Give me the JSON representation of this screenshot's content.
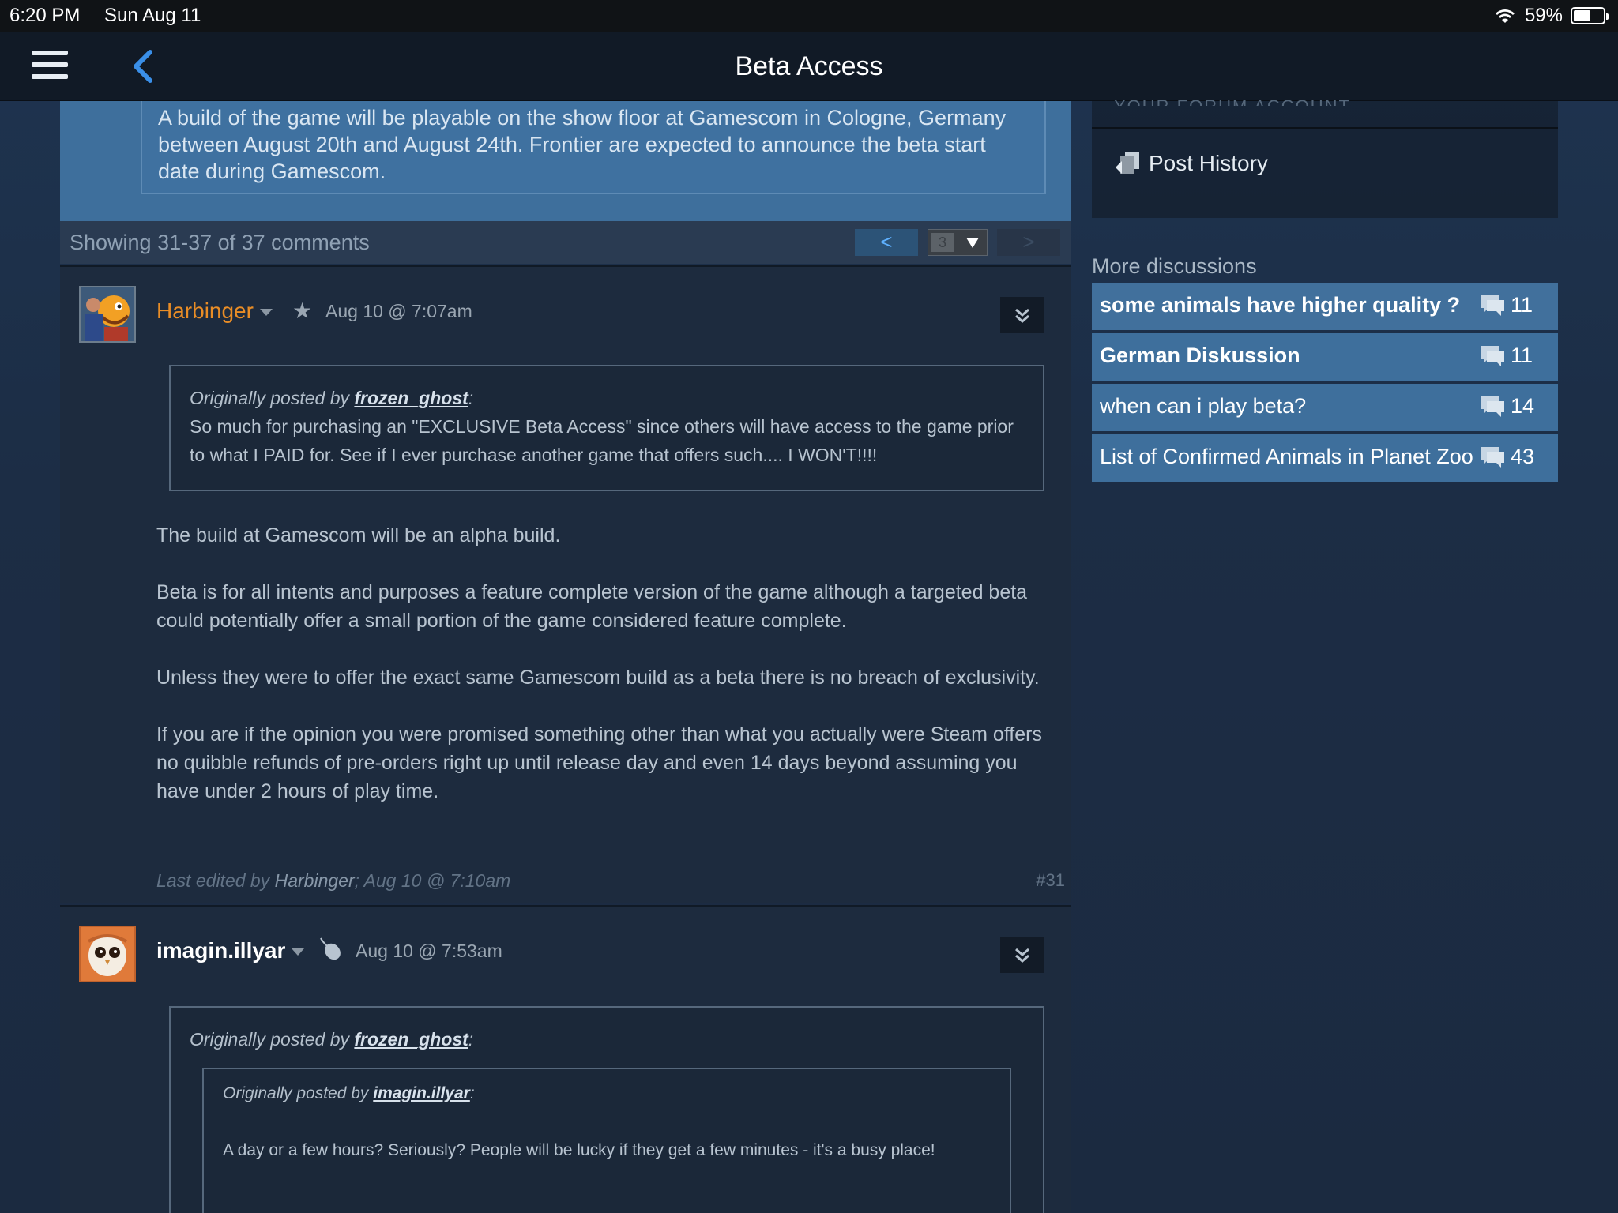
{
  "status_bar": {
    "time": "6:20 PM",
    "date": "Sun Aug 11",
    "battery": "59%",
    "battery_level": 0.59
  },
  "nav": {
    "title": "Beta Access",
    "menu_icon": "hamburger-icon",
    "back_icon": "chevron-left-icon"
  },
  "topic": {
    "quote_text": "A build of the game will be playable on the show floor at Gamescom in Cologne, Germany between August 20th and August 24th. Frontier are expected to announce the beta start date during Gamescom."
  },
  "pager": {
    "count": "Showing 31-37 of 37 comments",
    "prev_label": "<",
    "next_label": ">",
    "page_value": "3"
  },
  "comments": [
    {
      "author": "Harbinger",
      "badge": "★",
      "timestamp": "Aug 10 @ 7:07am",
      "quote_prefix": "Originally posted by",
      "quote_author": "frozen_ghost",
      "quote_suffix": ":",
      "quote_text": "So much for purchasing an \"EXCLUSIVE Beta Access\" since others will have access to the game prior to what I PAID for. See if I ever purchase another game that offers such.... I WON'T!!!!",
      "paragraphs": [
        "The build at Gamescom will be an alpha build.",
        "Beta is for all intents and purposes a feature complete version of the game although a targeted beta could potentially offer a small portion of the game considered feature complete.",
        "Unless they were to offer the exact same Gamescom build as a beta there is no breach of exclusivity.",
        "If you are if the opinion you were promised something other than what you actually were Steam offers no quibble refunds of pre-orders right up until release day and even 14 days beyond assuming you have under 2 hours of play time."
      ],
      "edit_prefix": "Last edited by",
      "edit_author": "Harbinger",
      "edit_suffix": "; Aug 10 @ 7:10am",
      "post_number": "#31"
    },
    {
      "author": "imagin.illyar",
      "timestamp": "Aug 10 @ 7:53am",
      "quote_prefix": "Originally posted by",
      "quote_author": "frozen_ghost",
      "quote_suffix": ":",
      "inner_quote_prefix": "Originally posted by",
      "inner_quote_author": "imagin.illyar",
      "inner_quote_suffix": ":",
      "inner_quote_text": "A day or a few hours? Seriously? People will be lucky if they get a few minutes - it's a busy place!"
    }
  ],
  "sidebar": {
    "panel_cut_text": "YOUR FORUM ACCOUNT",
    "post_history": "Post History",
    "more_label": "More discussions",
    "discussions": [
      {
        "title": "some animals have higher quality ?",
        "count": "11",
        "bold": true
      },
      {
        "title": "German Diskussion",
        "count": "11",
        "bold": true
      },
      {
        "title": "when can i play beta?",
        "count": "14",
        "bold": false
      },
      {
        "title": "List of Confirmed Animals in Planet Zoo",
        "count": "43",
        "bold": false
      }
    ]
  },
  "colors": {
    "accent_blue": "#3e6f9c",
    "author_orange": "#e98d26",
    "link_blue": "#5fb1ff"
  }
}
